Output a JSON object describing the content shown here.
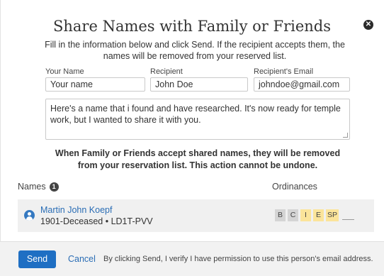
{
  "dialog": {
    "title": "Share Names with Family or Friends",
    "instructions": "Fill in the information below and click Send. If the recipient accepts them, the names will be removed from your reserved list.",
    "close_icon": "close-icon"
  },
  "form": {
    "your_name_label": "Your Name",
    "your_name_value": "Your name",
    "recipient_label": "Recipient",
    "recipient_value": "John Doe",
    "email_label": "Recipient's Email",
    "email_value": "johndoe@gmail.com",
    "message": "Here's a name that i found and have researched.  It's now ready for temple work, but I wanted to share it with you."
  },
  "warning": "When Family or Friends accept shared names, they will be removed from your reservation list. This action cannot be undone.",
  "names": {
    "header": "Names",
    "count": "1",
    "ordinances_header": "Ordinances",
    "rows": [
      {
        "name": "Martin John Koepf",
        "details": "1901-Deceased • LD1T-PVV",
        "icon": "person-icon",
        "ordinances": [
          {
            "code": "B",
            "color": "#d4d4d4"
          },
          {
            "code": "C",
            "color": "#d4d4d4"
          },
          {
            "code": "I",
            "color": "#fbe49a"
          },
          {
            "code": "E",
            "color": "#fbe49a"
          },
          {
            "code": "SP",
            "color": "#fbe49a"
          }
        ]
      }
    ]
  },
  "footer": {
    "send_label": "Send",
    "cancel_label": "Cancel",
    "disclaimer": "By clicking Send, I verify I have permission to use this person's email address."
  },
  "colors": {
    "accent": "#1f6fc3",
    "link": "#2a6db5",
    "ordinance_pending": "#fbe49a",
    "ordinance_done": "#d4d4d4"
  }
}
